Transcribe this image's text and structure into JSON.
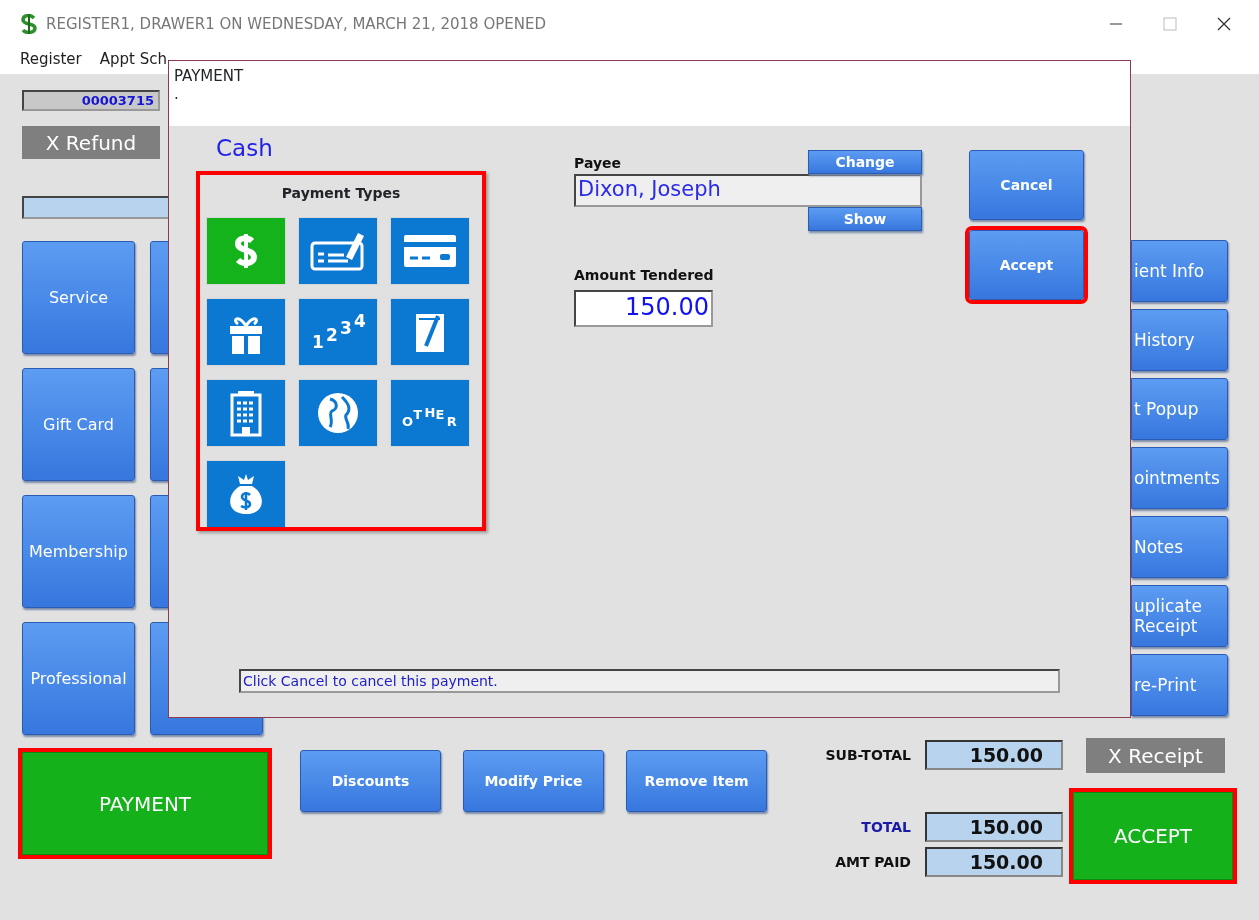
{
  "window": {
    "title": "REGISTER1, DRAWER1 ON WEDNESDAY, MARCH 21, 2018 OPENED"
  },
  "menu": [
    "Register",
    "Appt Sch"
  ],
  "receipt_number": "00003715",
  "refund_button": "X Refund",
  "category_buttons": [
    {
      "label": "Service"
    },
    {
      "label": "Gift Card"
    },
    {
      "label": "Membership"
    },
    {
      "label": "Professional"
    }
  ],
  "side_buttons": [
    "ient Info",
    "History",
    "t Popup",
    "ointments",
    "Notes",
    "uplicate Receipt",
    "re-Print"
  ],
  "payment_button": {
    "label": "PAYMENT",
    "highlighted": true
  },
  "actions": [
    "Discounts",
    "Modify Price",
    "Remove Item"
  ],
  "totals": [
    {
      "label": "SUB-TOTAL",
      "value": "150.00",
      "accent": false
    },
    {
      "label": "TOTAL",
      "value": "150.00",
      "accent": true
    },
    {
      "label": "AMT PAID",
      "value": "150.00",
      "accent": false
    }
  ],
  "receipt_button": "X Receipt",
  "accept_button": {
    "label": "ACCEPT",
    "highlighted": true
  },
  "dialog": {
    "title": "PAYMENT",
    "subtitle": ".",
    "method": "Cash",
    "payment_types": {
      "title": "Payment Types",
      "highlighted": true,
      "tiles": [
        {
          "kind": "cash",
          "selected": true
        },
        {
          "kind": "check",
          "selected": false
        },
        {
          "kind": "card",
          "selected": false
        },
        {
          "kind": "gift",
          "selected": false
        },
        {
          "kind": "numbers",
          "label": "1234",
          "selected": false
        },
        {
          "kind": "note",
          "selected": false
        },
        {
          "kind": "building",
          "selected": false
        },
        {
          "kind": "globe",
          "selected": false
        },
        {
          "kind": "other",
          "label": "OTHER",
          "selected": false
        },
        {
          "kind": "bag",
          "selected": false
        }
      ]
    },
    "payee": {
      "label": "Payee",
      "value": "Dixon, Joseph",
      "change": "Change",
      "show": "Show"
    },
    "amount": {
      "label": "Amount Tendered",
      "value": "150.00"
    },
    "buttons": [
      {
        "label": "Cancel",
        "highlighted": false
      },
      {
        "label": "Accept",
        "highlighted": true
      }
    ],
    "status": "Click Cancel to cancel this payment."
  }
}
